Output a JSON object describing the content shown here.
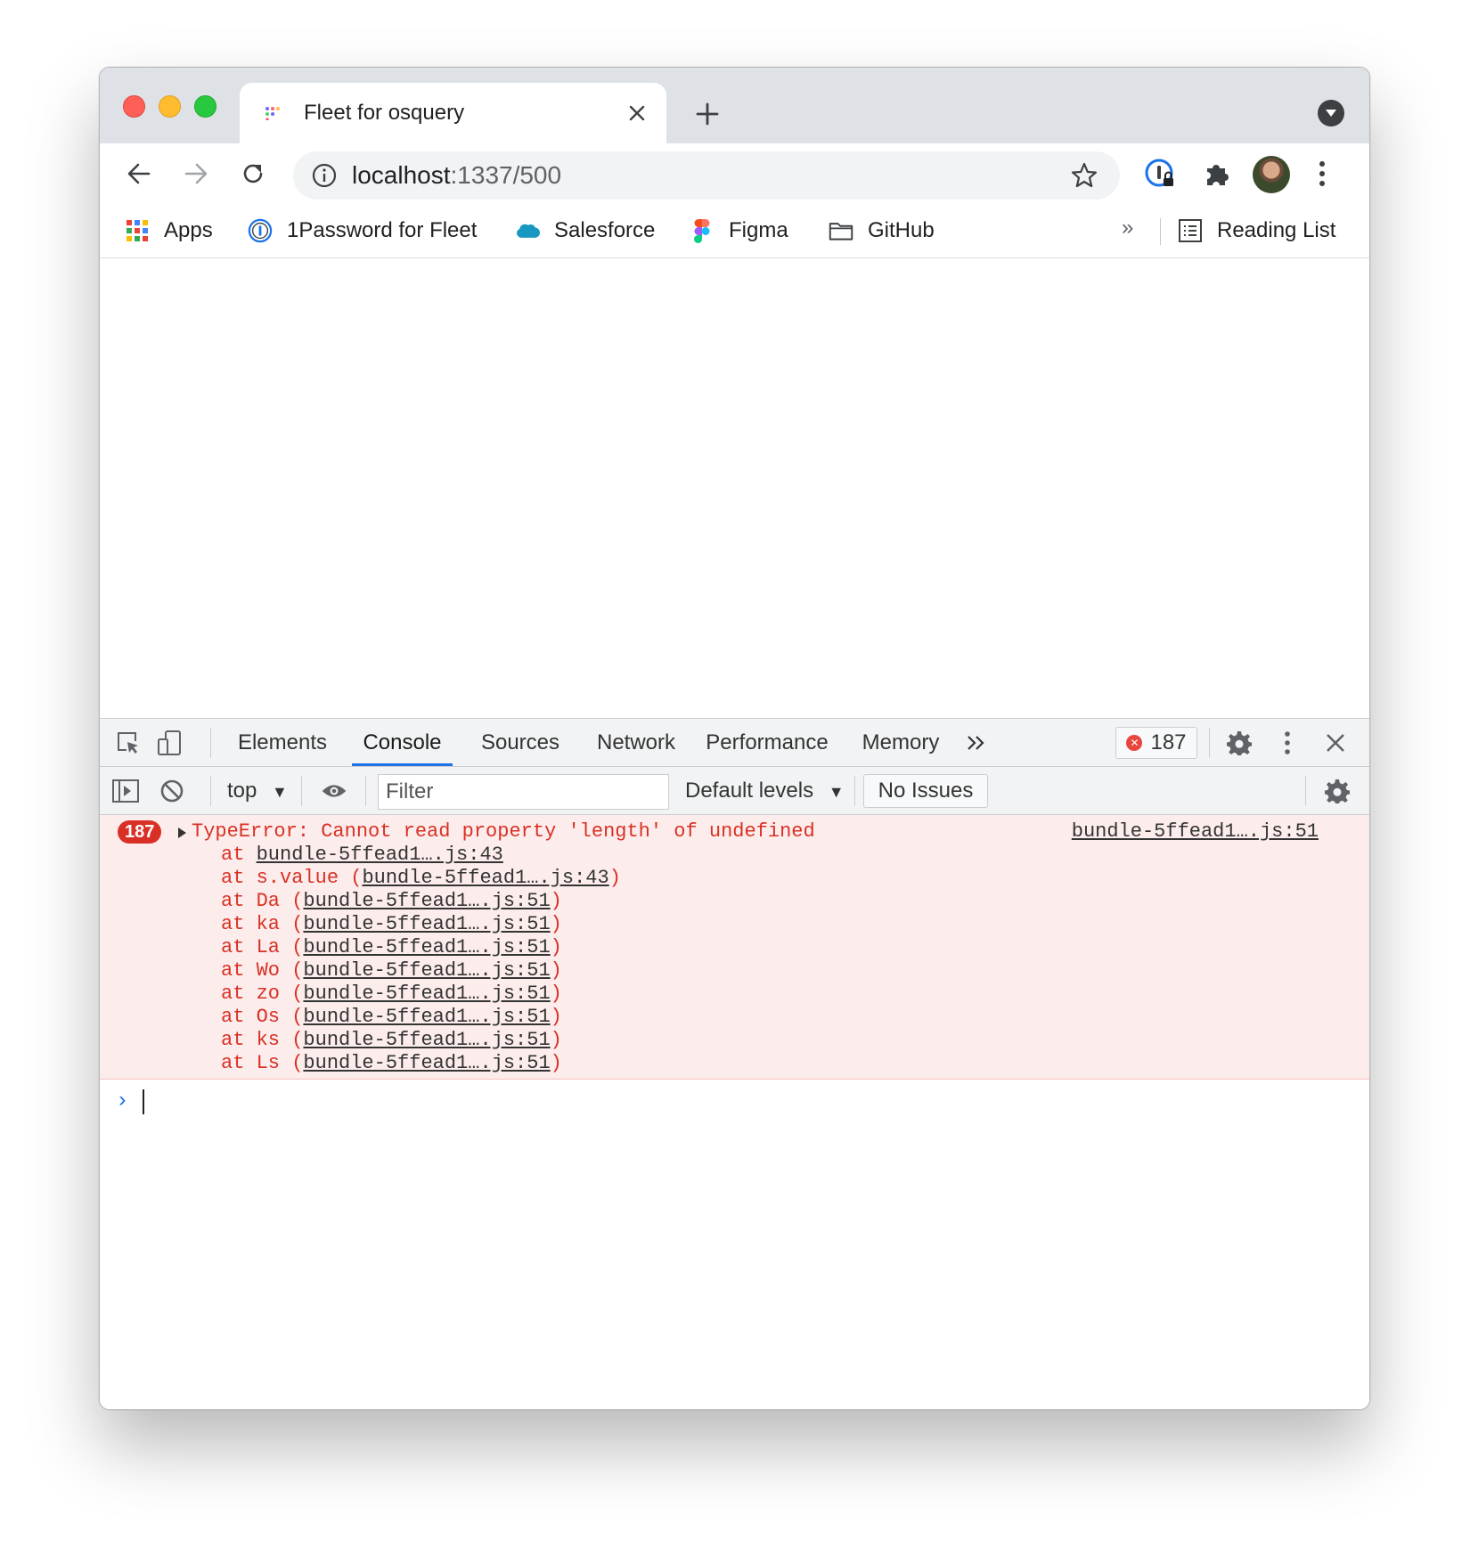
{
  "tab": {
    "title": "Fleet for osquery"
  },
  "omnibox": {
    "host": "localhost",
    "path": ":1337/500"
  },
  "bookmarks": {
    "items": [
      {
        "label": "Apps",
        "icon": "apps-grid-icon"
      },
      {
        "label": "1Password for Fleet",
        "icon": "1password-icon"
      },
      {
        "label": "Salesforce",
        "icon": "salesforce-cloud-icon"
      },
      {
        "label": "Figma",
        "icon": "figma-icon"
      },
      {
        "label": "GitHub",
        "icon": "folder-icon"
      }
    ],
    "more": "»",
    "reading_list": "Reading List"
  },
  "devtools": {
    "tabs": [
      "Elements",
      "Console",
      "Sources",
      "Network",
      "Performance",
      "Memory"
    ],
    "active_tab": "Console",
    "error_count": "187",
    "context": "top",
    "filter_placeholder": "Filter",
    "levels": "Default levels",
    "issues": "No Issues"
  },
  "console": {
    "badge": "187",
    "message": "TypeError: Cannot read property 'length' of undefined",
    "source": "bundle-5ffead1….js:51",
    "stack": [
      {
        "prefix": "at ",
        "fn": "",
        "link": "bundle-5ffead1….js:43"
      },
      {
        "prefix": "at s.value (",
        "fn": "s.value",
        "link": "bundle-5ffead1….js:43"
      },
      {
        "prefix": "at Da (",
        "fn": "Da",
        "link": "bundle-5ffead1….js:51"
      },
      {
        "prefix": "at ka (",
        "fn": "ka",
        "link": "bundle-5ffead1….js:51"
      },
      {
        "prefix": "at La (",
        "fn": "La",
        "link": "bundle-5ffead1….js:51"
      },
      {
        "prefix": "at Wo (",
        "fn": "Wo",
        "link": "bundle-5ffead1….js:51"
      },
      {
        "prefix": "at zo (",
        "fn": "zo",
        "link": "bundle-5ffead1….js:51"
      },
      {
        "prefix": "at Os (",
        "fn": "Os",
        "link": "bundle-5ffead1….js:51"
      },
      {
        "prefix": "at ks (",
        "fn": "ks",
        "link": "bundle-5ffead1….js:51"
      },
      {
        "prefix": "at Ls (",
        "fn": "Ls",
        "link": "bundle-5ffead1….js:51"
      }
    ],
    "prompt": "›"
  },
  "colors": {
    "error_red": "#d93025",
    "error_bg": "#fcedec",
    "accent_blue": "#1a73e8"
  }
}
